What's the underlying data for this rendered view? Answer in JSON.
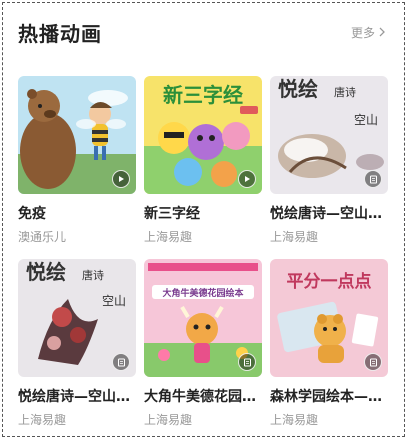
{
  "section": {
    "title": "热播动画",
    "more_label": "更多"
  },
  "cards": [
    {
      "title": "免疫",
      "publisher": "澳通乐儿",
      "badge": "play-icon",
      "art": {
        "banner": ""
      }
    },
    {
      "title": "新三字经",
      "publisher": "上海易趣",
      "badge": "play-icon",
      "art": {
        "banner": "新三字经"
      }
    },
    {
      "title": "悦绘唐诗—空山…",
      "publisher": "上海易趣",
      "badge": "book-icon",
      "art": {
        "banner": "悦绘",
        "sub": "唐诗",
        "poem": "空山"
      }
    },
    {
      "title": "悦绘唐诗—空山…",
      "publisher": "上海易趣",
      "badge": "book-icon",
      "art": {
        "banner": "悦绘",
        "sub": "唐诗",
        "poem": "空山"
      }
    },
    {
      "title": "大角牛美德花园…",
      "publisher": "上海易趣",
      "badge": "book-icon",
      "art": {
        "banner": "大角牛美德花园绘本"
      }
    },
    {
      "title": "森林学园绘本—…",
      "publisher": "上海易趣",
      "badge": "book-icon",
      "art": {
        "banner": "平分一点点"
      }
    }
  ],
  "colors": {
    "title": "#222222",
    "muted": "#999999",
    "accent_pink": "#e8508a"
  }
}
